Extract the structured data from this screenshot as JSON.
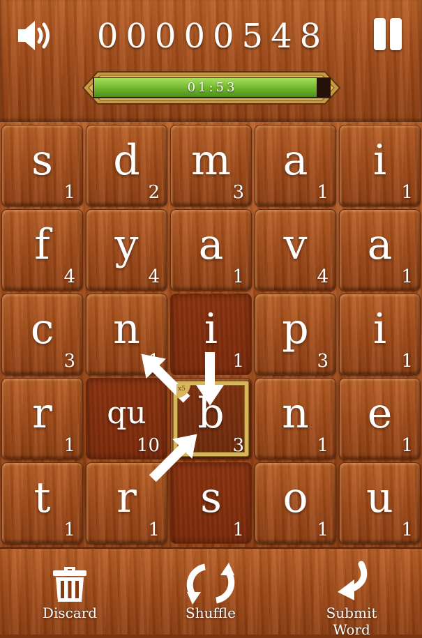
{
  "header": {
    "score": "00000548",
    "timer": "01:53",
    "timer_progress": 0.94,
    "sound_icon": "speaker-icon",
    "pause_icon": "pause-icon"
  },
  "board": {
    "rows": [
      [
        {
          "l": "s",
          "p": "1"
        },
        {
          "l": "d",
          "p": "2"
        },
        {
          "l": "m",
          "p": "3"
        },
        {
          "l": "a",
          "p": "1"
        },
        {
          "l": "i",
          "p": "1"
        }
      ],
      [
        {
          "l": "f",
          "p": "4"
        },
        {
          "l": "y",
          "p": "4"
        },
        {
          "l": "a",
          "p": "1"
        },
        {
          "l": "v",
          "p": "4"
        },
        {
          "l": "a",
          "p": "1"
        }
      ],
      [
        {
          "l": "c",
          "p": "3"
        },
        {
          "l": "n",
          "p": "1"
        },
        {
          "l": "i",
          "p": "1"
        },
        {
          "l": "p",
          "p": "3"
        },
        {
          "l": "i",
          "p": "1"
        }
      ],
      [
        {
          "l": "r",
          "p": "1"
        },
        {
          "l": "qu",
          "p": "10"
        },
        {
          "l": "b",
          "p": "3"
        },
        {
          "l": "n",
          "p": "1"
        },
        {
          "l": "e",
          "p": "1"
        }
      ],
      [
        {
          "l": "t",
          "p": "1"
        },
        {
          "l": "r",
          "p": "1"
        },
        {
          "l": "s",
          "p": "1"
        },
        {
          "l": "o",
          "p": "1"
        },
        {
          "l": "u",
          "p": "1"
        }
      ]
    ],
    "selected": [
      [
        2,
        2
      ],
      [
        3,
        1
      ],
      [
        4,
        2
      ]
    ],
    "active": [
      3,
      2
    ],
    "active_badge": "x5"
  },
  "footer": {
    "discard_label": "Discard",
    "shuffle_label": "Shuffle",
    "submit_label": "Submit Word"
  },
  "colors": {
    "wood": "#a24a17",
    "timer_green": "#6fb52c",
    "gold_frame": "#d8b45a"
  }
}
